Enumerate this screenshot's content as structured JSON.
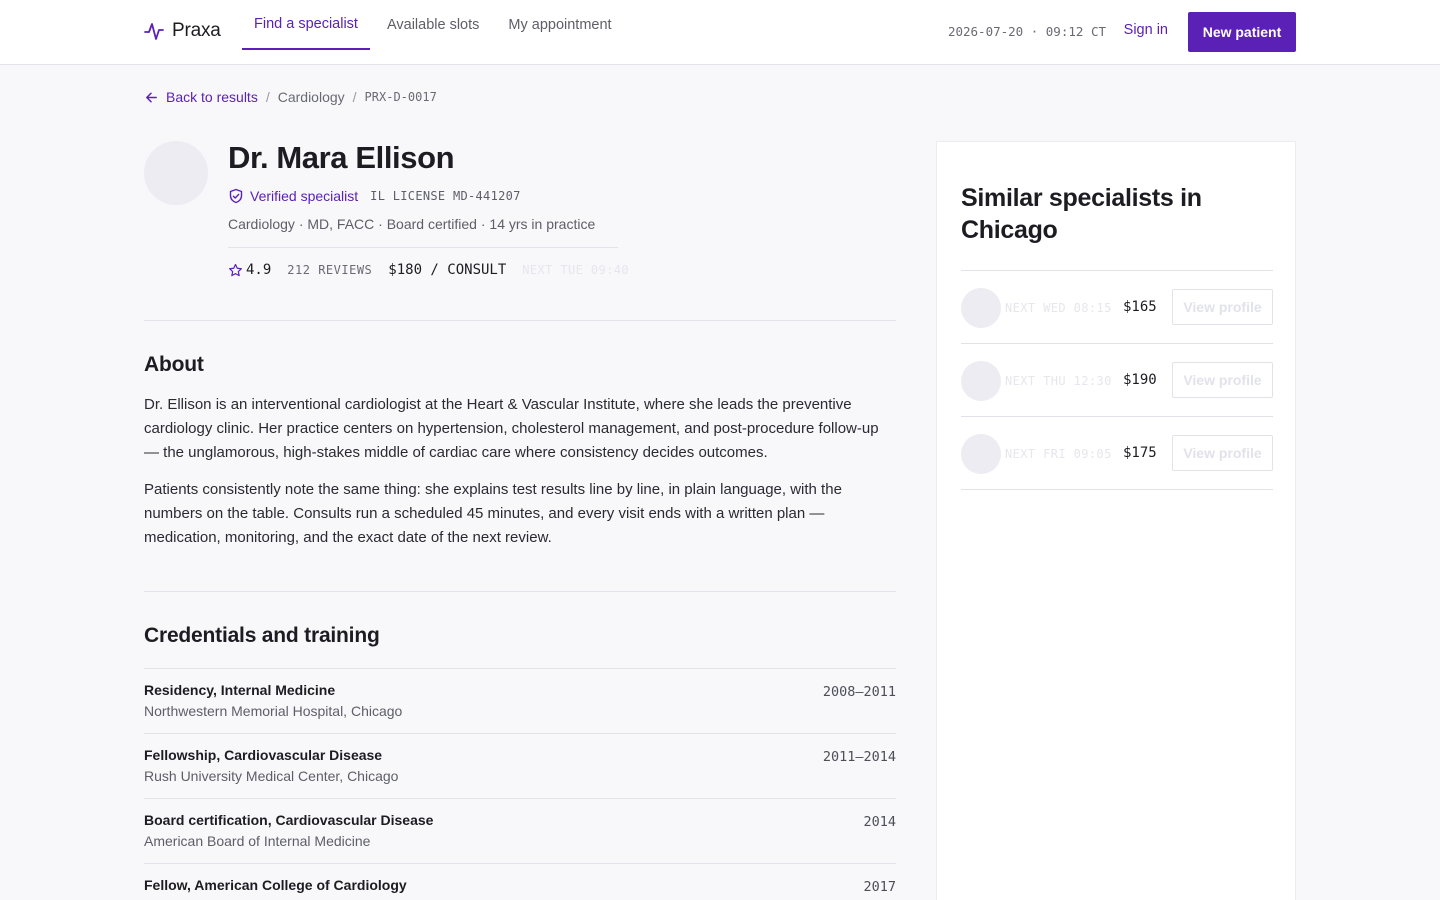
{
  "app": {
    "brand": "Praxa"
  },
  "nav": {
    "tabs": [
      {
        "label": "Find a specialist",
        "active": true
      },
      {
        "label": "Available slots",
        "active": false
      },
      {
        "label": "My appointment",
        "active": false
      }
    ],
    "clock": "2026-07-20 · 09:12 CT",
    "sign_in": "Sign in",
    "new_patient": "New patient"
  },
  "breadcrumb": {
    "back": "Back to results",
    "separator": "/",
    "category": "Cardiology",
    "code": "PRX-D-0017"
  },
  "profile": {
    "name": "Dr. Mara Ellison",
    "verified": "Verified specialist",
    "license": "IL LICENSE MD-441207",
    "subinfo": "Cardiology · MD, FACC · Board certified · 14 yrs in practice",
    "rating": "4.9",
    "reviews": "212 REVIEWS",
    "price": "$180 / CONSULT",
    "next_slot": "NEXT TUE 09:40"
  },
  "about": {
    "title": "About",
    "paragraphs": [
      "Dr. Ellison is an interventional cardiologist at the Heart & Vascular Institute, where she leads the preventive cardiology clinic. Her practice centers on hypertension, cholesterol management, and post-procedure follow-up — the unglamorous, high-stakes middle of cardiac care where consistency decides outcomes.",
      "Patients consistently note the same thing: she explains test results line by line, in plain language, with the numbers on the table. Consults run a scheduled 45 minutes, and every visit ends with a written plan — medication, monitoring, and the exact date of the next review."
    ]
  },
  "credentials": {
    "title": "Credentials and training",
    "items": [
      {
        "title": "Residency, Internal Medicine",
        "org": "Northwestern Memorial Hospital, Chicago",
        "year": "2008–2011"
      },
      {
        "title": "Fellowship, Cardiovascular Disease",
        "org": "Rush University Medical Center, Chicago",
        "year": "2011–2014"
      },
      {
        "title": "Board certification, Cardiovascular Disease",
        "org": "American Board of Internal Medicine",
        "year": "2014"
      },
      {
        "title": "Fellow, American College of Cardiology",
        "org": "",
        "year": "2017"
      }
    ]
  },
  "similar": {
    "title": "Similar specialists in Chicago",
    "items": [
      {
        "next_slot": "NEXT WED 08:15",
        "price": "$165",
        "button": "View profile"
      },
      {
        "next_slot": "NEXT THU 12:30",
        "price": "$190",
        "button": "View profile"
      },
      {
        "next_slot": "NEXT FRI 09:05",
        "price": "$175",
        "button": "View profile"
      }
    ]
  },
  "icons": {
    "brand": "pulse-icon",
    "back": "arrow-left-icon",
    "verified": "shield-check-icon",
    "rating": "star-outline-icon"
  },
  "colors": {
    "accent": "#5b21b6",
    "background": "#f8f8fa",
    "surface": "#ffffff",
    "text": "#1c1c22",
    "muted": "#5e5e68"
  }
}
